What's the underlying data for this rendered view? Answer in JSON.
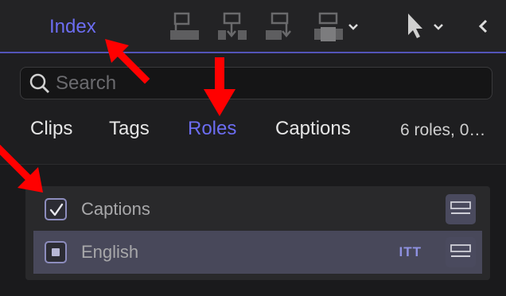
{
  "toolbar": {
    "index_label": "Index",
    "icons": [
      "connect-clip-icon",
      "insert-clip-icon",
      "append-clip-icon",
      "overwrite-clip-icon",
      "select-tool-icon",
      "back-icon"
    ]
  },
  "search": {
    "placeholder": "Search",
    "value": ""
  },
  "tabs": [
    {
      "label": "Clips",
      "active": false
    },
    {
      "label": "Tags",
      "active": false
    },
    {
      "label": "Roles",
      "active": true
    },
    {
      "label": "Captions",
      "active": false
    }
  ],
  "status": "6 roles, 0…",
  "roles": [
    {
      "label": "Captions",
      "checked": true,
      "badge": "",
      "selected": false
    },
    {
      "label": "English",
      "checked": "mixed",
      "badge": "ITT",
      "selected": true
    }
  ],
  "colors": {
    "accent": "#6c6df2",
    "annotation": "#ff0000",
    "selected_row": "#48485a"
  }
}
